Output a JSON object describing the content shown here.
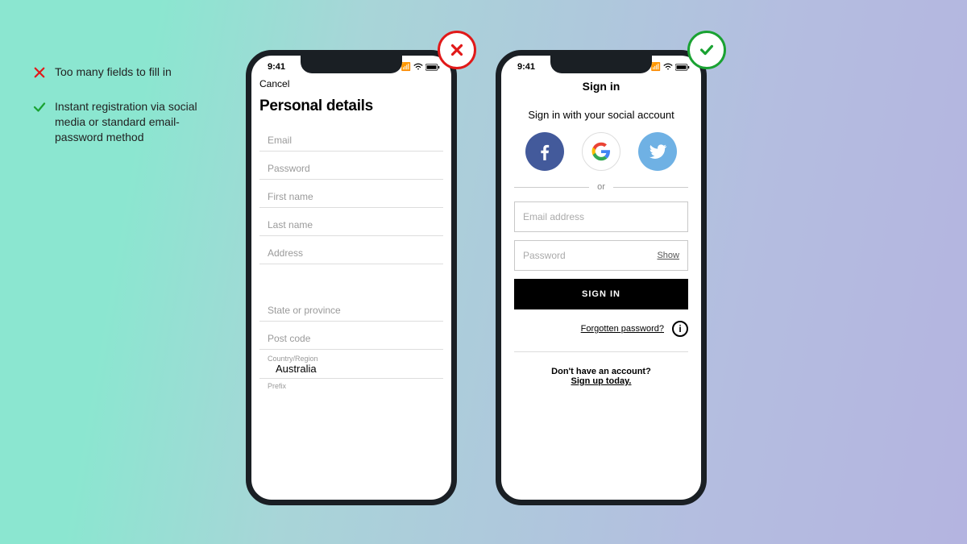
{
  "annotations": {
    "bad": "Too many fields to fill in",
    "good": "Instant registration via social media or standard email-password method"
  },
  "colors": {
    "bad": "#e11919",
    "good": "#1aa232"
  },
  "status": {
    "time": "9:41"
  },
  "phone_bad": {
    "cancel": "Cancel",
    "title": "Personal details",
    "fields": {
      "email": "Email",
      "password": "Password",
      "first_name": "First name",
      "last_name": "Last name",
      "address": "Address",
      "state": "State or province",
      "postcode": "Post code"
    },
    "country_label": "Country/Region",
    "country_value": "Australia",
    "prefix_label": "Prefix"
  },
  "phone_good": {
    "title": "Sign in",
    "subtitle": "Sign in with your social account",
    "icons": {
      "facebook": "facebook-icon",
      "google": "google-icon",
      "twitter": "twitter-icon"
    },
    "or": "or",
    "email_placeholder": "Email address",
    "password_placeholder": "Password",
    "show": "Show",
    "signin_button": "SIGN IN",
    "forgot": "Forgotten password?",
    "no_account": "Don't have an account?",
    "signup": "Sign up today."
  }
}
